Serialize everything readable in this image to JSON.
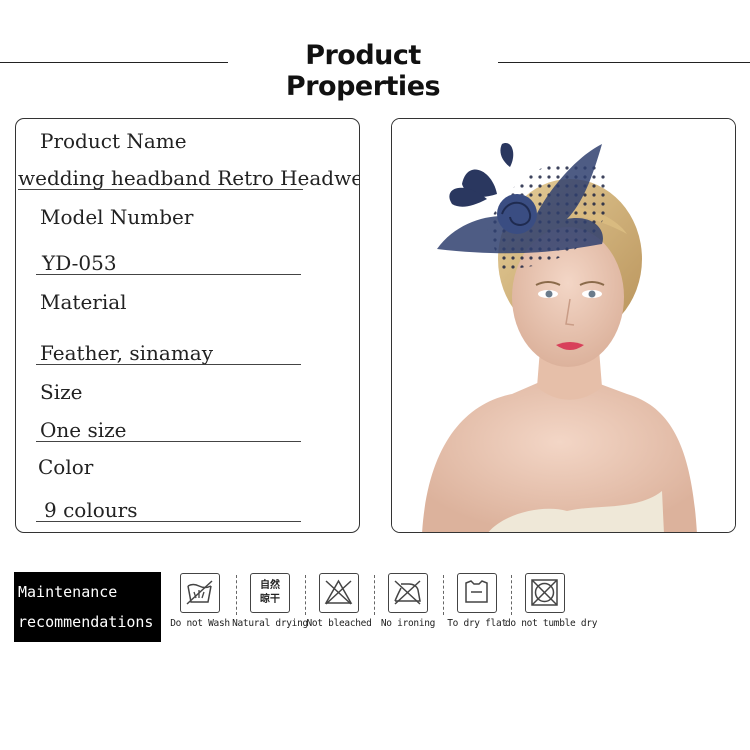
{
  "header": {
    "title": "Product Properties"
  },
  "specs": {
    "product_name_label": "Product Name",
    "product_name_value": "wedding headband Retro Headwear",
    "model_number_label": "Model Number",
    "model_number_value": "YD-053",
    "material_label": "Material",
    "material_value": "Feather, sinamay",
    "size_label": "Size",
    "size_value": "One size",
    "color_label": "Color",
    "color_value": "9 colours"
  },
  "maintenance": {
    "title_line1": "Maintenance",
    "title_line2": "recommendations",
    "icons": [
      {
        "icon": "no-wash-icon",
        "label": "Do not Wash"
      },
      {
        "icon": "natural-drying-icon",
        "label": "Natural drying",
        "glyph_top": "自然",
        "glyph_bottom": "晾干"
      },
      {
        "icon": "no-bleach-icon",
        "label": "Not bleached"
      },
      {
        "icon": "no-ironing-icon",
        "label": "No ironing"
      },
      {
        "icon": "dry-flat-icon",
        "label": "To dry flat"
      },
      {
        "icon": "no-tumble-dry-icon",
        "label": "do not tumble dry"
      }
    ]
  },
  "colors": {
    "accent": "#2f3f6e",
    "border": "#333333"
  }
}
